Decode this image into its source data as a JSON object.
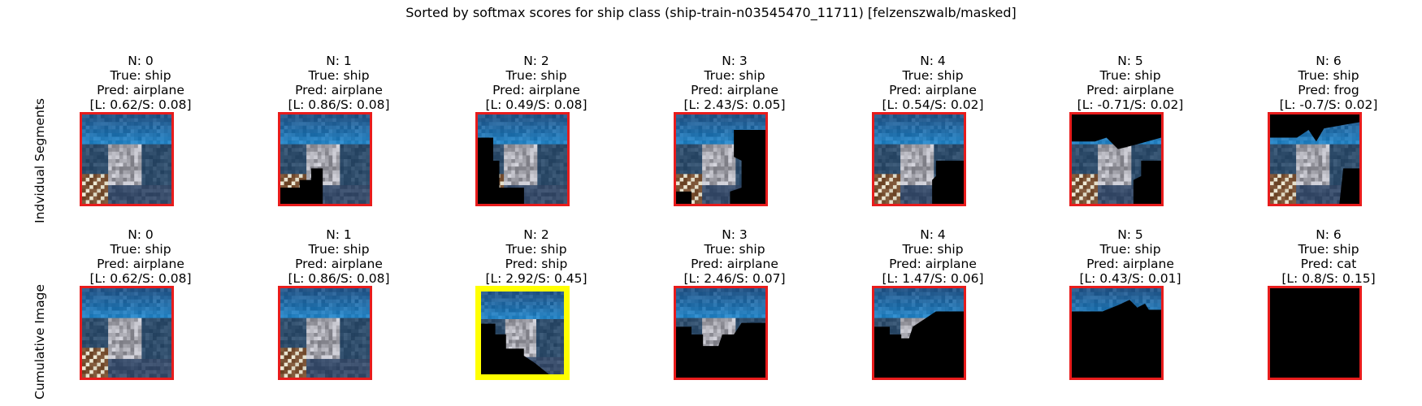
{
  "chart_data": {
    "type": "image-grid",
    "title": "Sorted by softmax scores for ship class (ship-train-n03545470_11711) [felzenszwalb/masked]",
    "rows": [
      {
        "label": "Indvidual Segments",
        "panels": [
          {
            "n": "N: 0",
            "true": "True: ship",
            "pred": "Pred: airplane",
            "scores": "[L: 0.62/S: 0.08]",
            "L": 0.62,
            "S": 0.08,
            "highlight": false,
            "mask": "none"
          },
          {
            "n": "N: 1",
            "true": "True: ship",
            "pred": "Pred: airplane",
            "scores": "[L: 0.86/S: 0.08]",
            "L": 0.86,
            "S": 0.08,
            "highlight": false,
            "mask": "bottom-left"
          },
          {
            "n": "N: 2",
            "true": "True: ship",
            "pred": "Pred: airplane",
            "scores": "[L: 0.49/S: 0.08]",
            "L": 0.49,
            "S": 0.08,
            "highlight": false,
            "mask": "left-bottom"
          },
          {
            "n": "N: 3",
            "true": "True: ship",
            "pred": "Pred: airplane",
            "scores": "[L: 2.43/S: 0.05]",
            "L": 2.43,
            "S": 0.05,
            "highlight": false,
            "mask": "right"
          },
          {
            "n": "N: 4",
            "true": "True: ship",
            "pred": "Pred: airplane",
            "scores": "[L: 0.54/S: 0.02]",
            "L": 0.54,
            "S": 0.02,
            "highlight": false,
            "mask": "bottom-right"
          },
          {
            "n": "N: 5",
            "true": "True: ship",
            "pred": "Pred: airplane",
            "scores": "[L: -0.71/S: 0.02]",
            "L": -0.71,
            "S": 0.02,
            "highlight": false,
            "mask": "top-right"
          },
          {
            "n": "N: 6",
            "true": "True: ship",
            "pred": "Pred: frog",
            "scores": "[L: -0.7/S: 0.02]",
            "L": -0.7,
            "S": 0.02,
            "highlight": false,
            "mask": "top"
          }
        ]
      },
      {
        "label": "Cumulative Image",
        "panels": [
          {
            "n": "N: 0",
            "true": "True: ship",
            "pred": "Pred: airplane",
            "scores": "[L: 0.62/S: 0.08]",
            "L": 0.62,
            "S": 0.08,
            "highlight": false,
            "mask": "none"
          },
          {
            "n": "N: 1",
            "true": "True: ship",
            "pred": "Pred: airplane",
            "scores": "[L: 0.86/S: 0.08]",
            "L": 0.86,
            "S": 0.08,
            "highlight": false,
            "mask": "none"
          },
          {
            "n": "N: 2",
            "true": "True: ship",
            "pred": "Pred: ship",
            "scores": "[L: 2.92/S: 0.45]",
            "L": 2.92,
            "S": 0.45,
            "highlight": true,
            "mask": "cum2"
          },
          {
            "n": "N: 3",
            "true": "True: ship",
            "pred": "Pred: airplane",
            "scores": "[L: 2.46/S: 0.07]",
            "L": 2.46,
            "S": 0.07,
            "highlight": false,
            "mask": "cum3"
          },
          {
            "n": "N: 4",
            "true": "True: ship",
            "pred": "Pred: airplane",
            "scores": "[L: 1.47/S: 0.06]",
            "L": 1.47,
            "S": 0.06,
            "highlight": false,
            "mask": "cum4"
          },
          {
            "n": "N: 5",
            "true": "True: ship",
            "pred": "Pred: airplane",
            "scores": "[L: 0.43/S: 0.01]",
            "L": 0.43,
            "S": 0.01,
            "highlight": false,
            "mask": "cum5"
          },
          {
            "n": "N: 6",
            "true": "True: ship",
            "pred": "Pred: cat",
            "scores": "[L: 0.8/S: 0.15]",
            "L": 0.8,
            "S": 0.15,
            "highlight": false,
            "mask": "all"
          }
        ]
      }
    ],
    "colors": {
      "frame": "#e81c1c",
      "highlight": "#ffff00",
      "mask": "#000000"
    }
  }
}
